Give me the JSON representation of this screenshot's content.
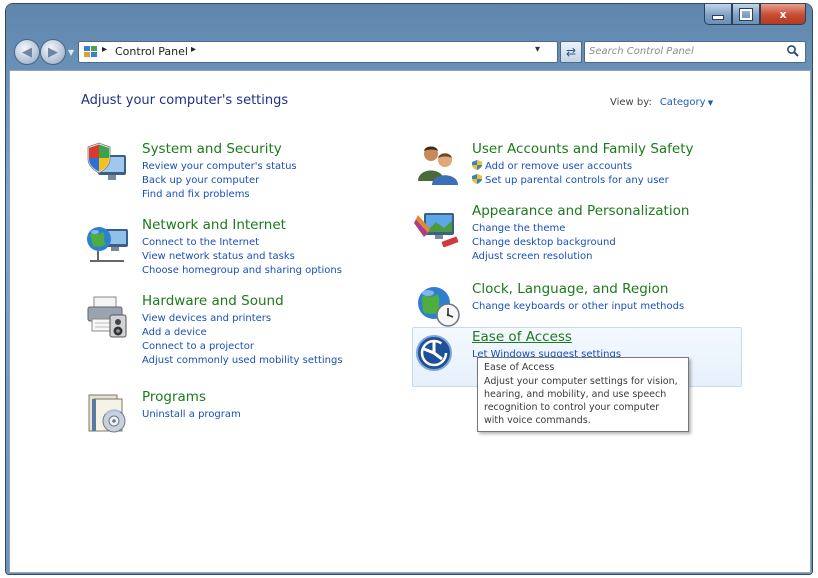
{
  "window": {
    "caption_buttons": {
      "minimize": "minimize",
      "maximize": "maximize",
      "close": "x"
    }
  },
  "nav": {
    "address_segments": [
      "Control Panel"
    ],
    "search_placeholder": "Search Control Panel"
  },
  "page": {
    "title": "Adjust your computer's settings",
    "view_by_label": "View by:",
    "view_by_value": "Category"
  },
  "categories": [
    {
      "title": "System and Security",
      "icon": "shield-computer-icon",
      "links": [
        "Review your computer's status",
        "Back up your computer",
        "Find and fix problems"
      ]
    },
    {
      "title": "Network and Internet",
      "icon": "network-globe-icon",
      "links": [
        "Connect to the Internet",
        "View network status and tasks",
        "Choose homegroup and sharing options"
      ]
    },
    {
      "title": "Hardware and Sound",
      "icon": "printer-speaker-icon",
      "links": [
        "View devices and printers",
        "Add a device",
        "Connect to a projector",
        "Adjust commonly used mobility settings"
      ]
    },
    {
      "title": "Programs",
      "icon": "programs-icon",
      "links": [
        "Uninstall a program"
      ]
    },
    {
      "title": "User Accounts and Family Safety",
      "icon": "users-icon",
      "links": [
        "Add or remove user accounts",
        "Set up parental controls for any user"
      ]
    },
    {
      "title": "Appearance and Personalization",
      "icon": "appearance-icon",
      "links": [
        "Change the theme",
        "Change desktop background",
        "Adjust screen resolution"
      ]
    },
    {
      "title": "Clock, Language, and Region",
      "icon": "clock-globe-icon",
      "links": [
        "Change keyboards or other input methods"
      ]
    },
    {
      "title": "Ease of Access",
      "icon": "ease-of-access-icon",
      "links": [
        "Let Windows suggest settings"
      ]
    }
  ],
  "tooltip": {
    "title": "Ease of Access",
    "body": "Adjust your computer settings for vision, hearing, and mobility, and use speech recognition to control your computer with voice commands."
  },
  "colors": {
    "category_title": "#1c7a1c",
    "link": "#1a4fba",
    "page_title": "#1e3287",
    "frame": "#6d94bb",
    "close_button": "#c84b33"
  }
}
